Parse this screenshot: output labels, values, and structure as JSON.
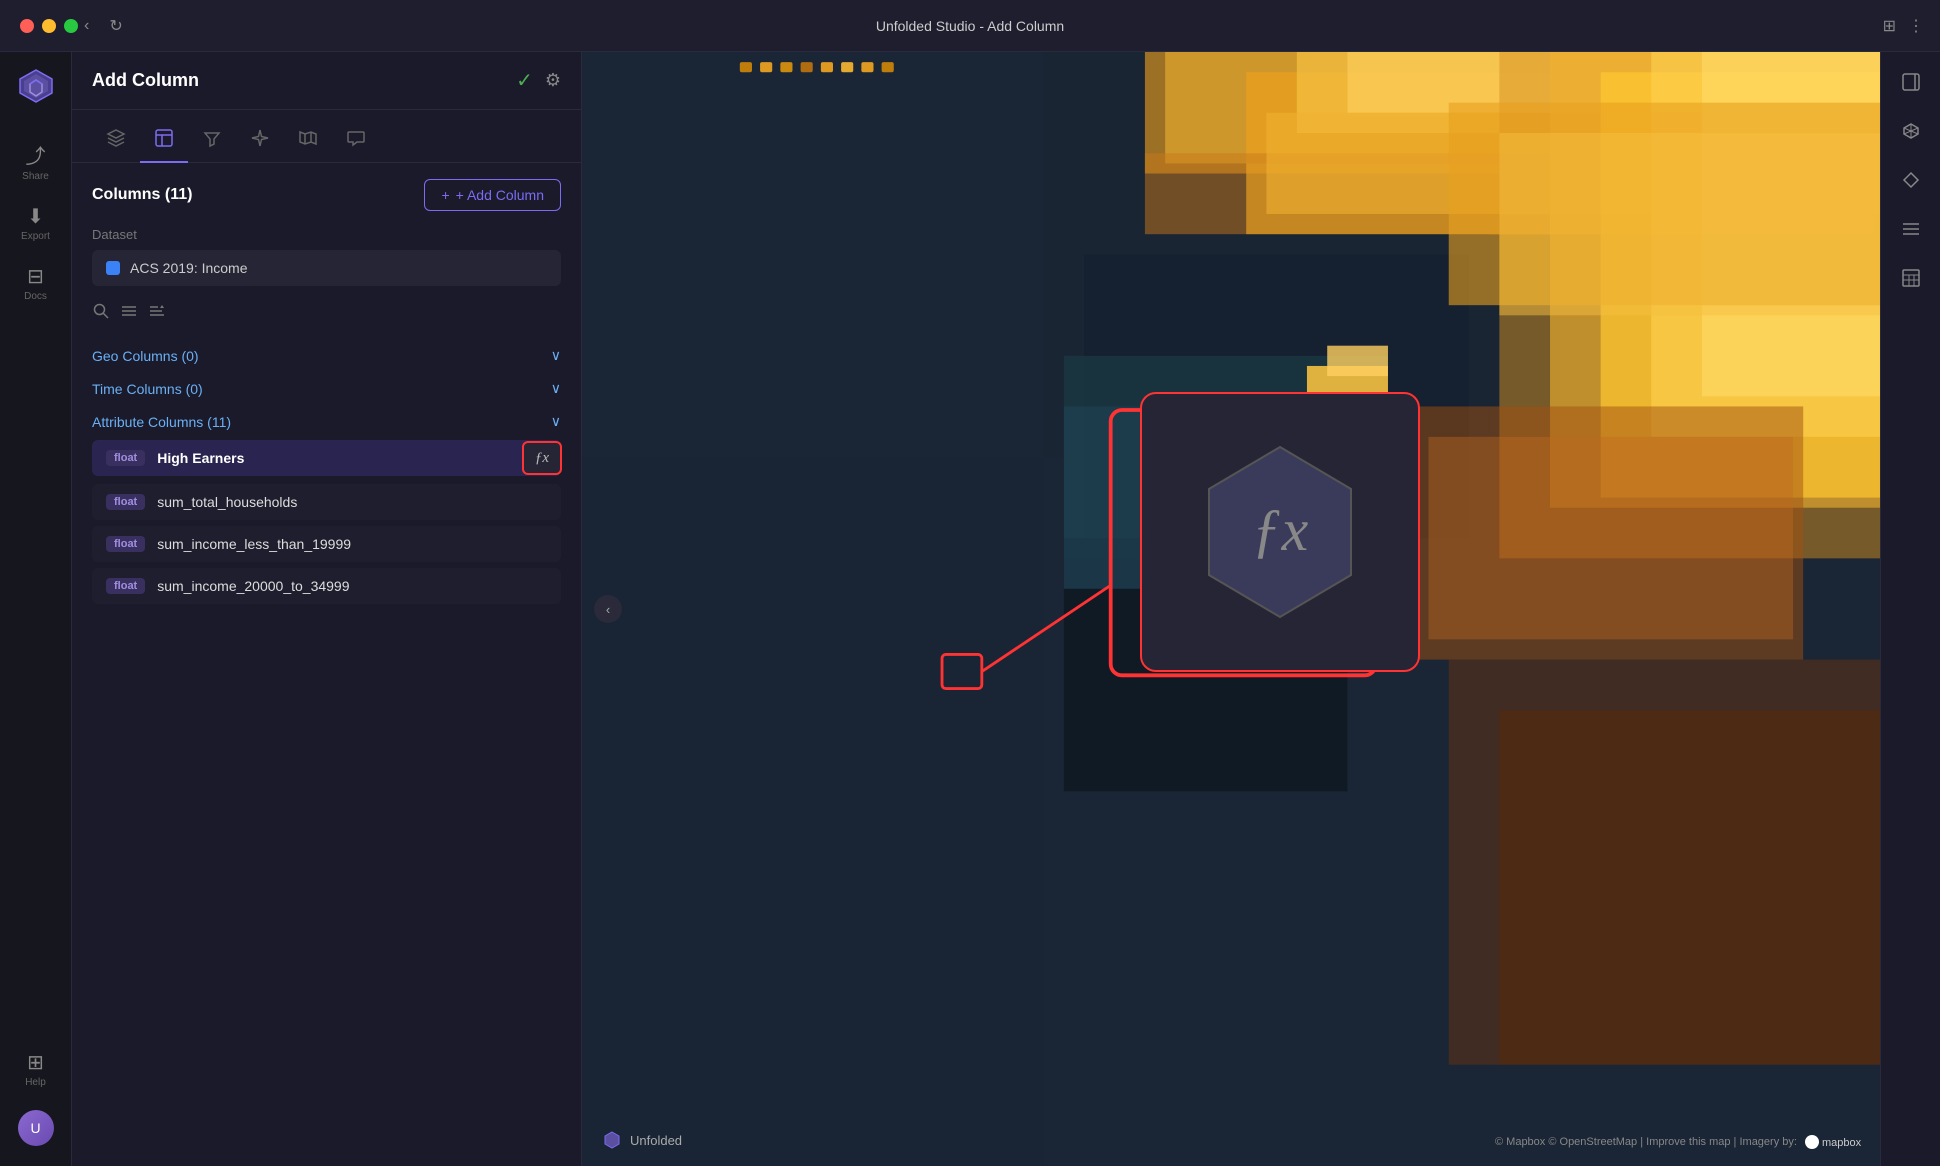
{
  "titlebar": {
    "title": "Unfolded Studio - Add Column",
    "back_btn": "‹",
    "refresh_btn": "↻",
    "puzzle_icon": "⊞",
    "dots_icon": "⋮"
  },
  "icon_sidebar": {
    "share_label": "Share",
    "export_label": "Export",
    "docs_label": "Docs",
    "help_label": "Help"
  },
  "panel": {
    "title": "Add Column",
    "columns_count": "Columns (11)",
    "add_column_btn": "+ Add Column",
    "dataset_label": "Dataset",
    "dataset_name": "ACS 2019: Income"
  },
  "tabs": [
    {
      "id": "layers",
      "icon": "⊞"
    },
    {
      "id": "table",
      "icon": "⊟",
      "active": true
    },
    {
      "id": "filter",
      "icon": "⊿"
    },
    {
      "id": "spark",
      "icon": "✦"
    },
    {
      "id": "map",
      "icon": "⊟"
    },
    {
      "id": "chat",
      "icon": "💬"
    }
  ],
  "sections": {
    "geo": {
      "label": "Geo Columns (0)",
      "count": 0
    },
    "time": {
      "label": "Time Columns (0)",
      "count": 0
    },
    "attribute": {
      "label": "Attribute Columns (11)",
      "count": 11
    }
  },
  "columns": [
    {
      "type": "float",
      "name": "High Earners",
      "highlighted": true,
      "has_fx": true
    },
    {
      "type": "float",
      "name": "sum_total_households",
      "highlighted": false
    },
    {
      "type": "float",
      "name": "sum_income_less_than_19999",
      "highlighted": false
    },
    {
      "type": "float",
      "name": "sum_income_20000_to_34999",
      "highlighted": false
    }
  ],
  "fx_popup": {
    "symbol": "ƒx"
  },
  "map": {
    "watermark": "Unfolded",
    "credit": "© Mapbox © OpenStreetMap  |  Improve this map  |  Imagery by:",
    "mapbox": "mapbox"
  },
  "right_sidebar_icons": [
    "⊟",
    "◻",
    "◈",
    "☰",
    "⊫"
  ]
}
